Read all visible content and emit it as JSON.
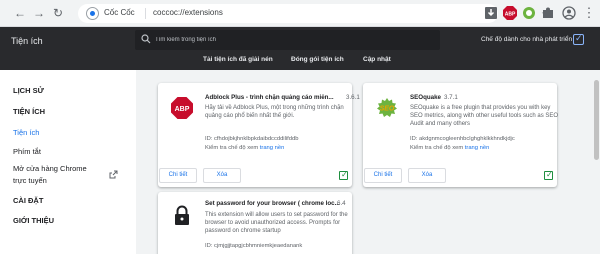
{
  "browser": {
    "site_name": "Cốc Cốc",
    "url": "coccoc://extensions",
    "extension_badge": "ABP"
  },
  "header": {
    "title": "Tiện ích",
    "search_placeholder": "Tìm kiếm trong tiện ích",
    "dev_mode_label": "Chế độ dành cho nhà phát triển",
    "actions": [
      "Tải tiện ích đã giải nén",
      "Đóng gói tiện ích",
      "Cập nhật"
    ]
  },
  "sidebar": {
    "history": "LỊCH SỬ",
    "extensions": "TIỆN ÍCH",
    "extensions_sub": "Tiện ích",
    "shortcuts": "Phím tắt",
    "store_line1": "Mở cửa hàng Chrome",
    "store_line2": "trực tuyến",
    "settings": "CÀI ĐẶT",
    "about": "GIỚI THIỆU"
  },
  "cards": [
    {
      "name": "Adblock Plus - trình chặn quảng cáo miễn...",
      "version": "3.6.1",
      "description": "Hãy tải về Adblock Plus, một trong những trình chặn quảng cáo phổ biến nhất thế giới.",
      "id": "ID: cfhdojbkjhnklbpkdaibdccddilifddb",
      "background_prefix": "Kiểm tra chế độ xem",
      "background_link": "trang nền",
      "details_label": "Chi tiết",
      "remove_label": "Xóa",
      "logo_text": "ABP",
      "enabled": true
    },
    {
      "name": "SEOquake",
      "version": "3.7.1",
      "description": "SEOquake is a free plugin that provides you with key SEO metrics, along with other useful tools such as SEO Audit and many others",
      "id": "ID: akdgnmcogleenhbclghghklkkhndkjdjc",
      "background_prefix": "Kiểm tra chế độ xem",
      "background_link": "trang nền",
      "details_label": "Chi tiết",
      "remove_label": "Xóa",
      "logo_text": "SEO",
      "enabled": true
    },
    {
      "name": "Set password for your browser ( chrome loc...",
      "version": "6.4",
      "description": "This extension will allow users to set password for the browser to avoid unauthorized access. Prompts for password on chrome startup",
      "id": "ID: cjmjgjjtapgjcbhmniemkjeaedanank"
    }
  ],
  "colors": {
    "header_bg": "#292a2d",
    "accent": "#1a73e8",
    "toggle_green": "#1e8e3e",
    "abp_red": "#c70d2c",
    "seo_green": "#6db33f"
  }
}
